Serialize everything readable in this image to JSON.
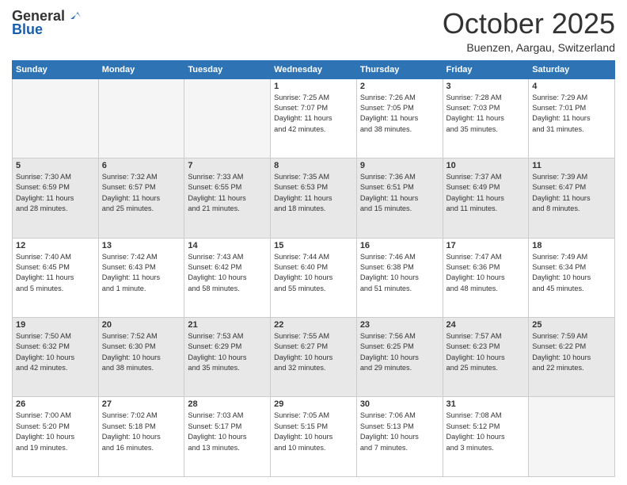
{
  "logo": {
    "general": "General",
    "blue": "Blue"
  },
  "header": {
    "month": "October 2025",
    "location": "Buenzen, Aargau, Switzerland"
  },
  "weekdays": [
    "Sunday",
    "Monday",
    "Tuesday",
    "Wednesday",
    "Thursday",
    "Friday",
    "Saturday"
  ],
  "weeks": [
    [
      {
        "day": "",
        "info": ""
      },
      {
        "day": "",
        "info": ""
      },
      {
        "day": "",
        "info": ""
      },
      {
        "day": "1",
        "info": "Sunrise: 7:25 AM\nSunset: 7:07 PM\nDaylight: 11 hours\nand 42 minutes."
      },
      {
        "day": "2",
        "info": "Sunrise: 7:26 AM\nSunset: 7:05 PM\nDaylight: 11 hours\nand 38 minutes."
      },
      {
        "day": "3",
        "info": "Sunrise: 7:28 AM\nSunset: 7:03 PM\nDaylight: 11 hours\nand 35 minutes."
      },
      {
        "day": "4",
        "info": "Sunrise: 7:29 AM\nSunset: 7:01 PM\nDaylight: 11 hours\nand 31 minutes."
      }
    ],
    [
      {
        "day": "5",
        "info": "Sunrise: 7:30 AM\nSunset: 6:59 PM\nDaylight: 11 hours\nand 28 minutes."
      },
      {
        "day": "6",
        "info": "Sunrise: 7:32 AM\nSunset: 6:57 PM\nDaylight: 11 hours\nand 25 minutes."
      },
      {
        "day": "7",
        "info": "Sunrise: 7:33 AM\nSunset: 6:55 PM\nDaylight: 11 hours\nand 21 minutes."
      },
      {
        "day": "8",
        "info": "Sunrise: 7:35 AM\nSunset: 6:53 PM\nDaylight: 11 hours\nand 18 minutes."
      },
      {
        "day": "9",
        "info": "Sunrise: 7:36 AM\nSunset: 6:51 PM\nDaylight: 11 hours\nand 15 minutes."
      },
      {
        "day": "10",
        "info": "Sunrise: 7:37 AM\nSunset: 6:49 PM\nDaylight: 11 hours\nand 11 minutes."
      },
      {
        "day": "11",
        "info": "Sunrise: 7:39 AM\nSunset: 6:47 PM\nDaylight: 11 hours\nand 8 minutes."
      }
    ],
    [
      {
        "day": "12",
        "info": "Sunrise: 7:40 AM\nSunset: 6:45 PM\nDaylight: 11 hours\nand 5 minutes."
      },
      {
        "day": "13",
        "info": "Sunrise: 7:42 AM\nSunset: 6:43 PM\nDaylight: 11 hours\nand 1 minute."
      },
      {
        "day": "14",
        "info": "Sunrise: 7:43 AM\nSunset: 6:42 PM\nDaylight: 10 hours\nand 58 minutes."
      },
      {
        "day": "15",
        "info": "Sunrise: 7:44 AM\nSunset: 6:40 PM\nDaylight: 10 hours\nand 55 minutes."
      },
      {
        "day": "16",
        "info": "Sunrise: 7:46 AM\nSunset: 6:38 PM\nDaylight: 10 hours\nand 51 minutes."
      },
      {
        "day": "17",
        "info": "Sunrise: 7:47 AM\nSunset: 6:36 PM\nDaylight: 10 hours\nand 48 minutes."
      },
      {
        "day": "18",
        "info": "Sunrise: 7:49 AM\nSunset: 6:34 PM\nDaylight: 10 hours\nand 45 minutes."
      }
    ],
    [
      {
        "day": "19",
        "info": "Sunrise: 7:50 AM\nSunset: 6:32 PM\nDaylight: 10 hours\nand 42 minutes."
      },
      {
        "day": "20",
        "info": "Sunrise: 7:52 AM\nSunset: 6:30 PM\nDaylight: 10 hours\nand 38 minutes."
      },
      {
        "day": "21",
        "info": "Sunrise: 7:53 AM\nSunset: 6:29 PM\nDaylight: 10 hours\nand 35 minutes."
      },
      {
        "day": "22",
        "info": "Sunrise: 7:55 AM\nSunset: 6:27 PM\nDaylight: 10 hours\nand 32 minutes."
      },
      {
        "day": "23",
        "info": "Sunrise: 7:56 AM\nSunset: 6:25 PM\nDaylight: 10 hours\nand 29 minutes."
      },
      {
        "day": "24",
        "info": "Sunrise: 7:57 AM\nSunset: 6:23 PM\nDaylight: 10 hours\nand 25 minutes."
      },
      {
        "day": "25",
        "info": "Sunrise: 7:59 AM\nSunset: 6:22 PM\nDaylight: 10 hours\nand 22 minutes."
      }
    ],
    [
      {
        "day": "26",
        "info": "Sunrise: 7:00 AM\nSunset: 5:20 PM\nDaylight: 10 hours\nand 19 minutes."
      },
      {
        "day": "27",
        "info": "Sunrise: 7:02 AM\nSunset: 5:18 PM\nDaylight: 10 hours\nand 16 minutes."
      },
      {
        "day": "28",
        "info": "Sunrise: 7:03 AM\nSunset: 5:17 PM\nDaylight: 10 hours\nand 13 minutes."
      },
      {
        "day": "29",
        "info": "Sunrise: 7:05 AM\nSunset: 5:15 PM\nDaylight: 10 hours\nand 10 minutes."
      },
      {
        "day": "30",
        "info": "Sunrise: 7:06 AM\nSunset: 5:13 PM\nDaylight: 10 hours\nand 7 minutes."
      },
      {
        "day": "31",
        "info": "Sunrise: 7:08 AM\nSunset: 5:12 PM\nDaylight: 10 hours\nand 3 minutes."
      },
      {
        "day": "",
        "info": ""
      }
    ]
  ]
}
